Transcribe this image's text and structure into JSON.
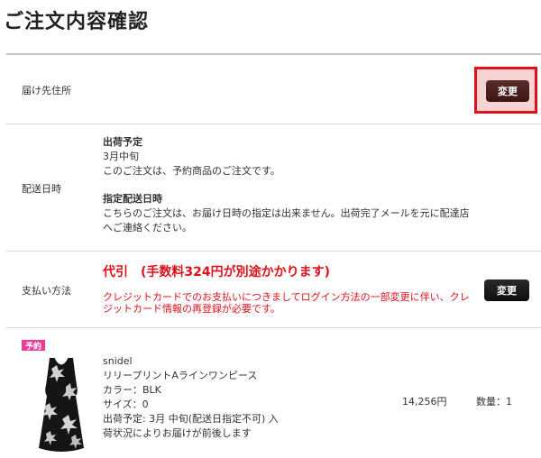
{
  "page": {
    "title": "ご注文内容確認"
  },
  "address": {
    "label": "届け先住所",
    "change_label": "変更"
  },
  "delivery": {
    "label": "配送日時",
    "ship_heading": "出荷予定",
    "ship_month": "3月中旬",
    "ship_note": "このご注文は、予約商品のご注文です。",
    "date_heading": "指定配送日時",
    "date_note_1": "こちらのご注文は、お届け日時の指定は出来ません。出荷完了メールを元に配達店",
    "date_note_2": "へご連絡ください。"
  },
  "payment": {
    "label": "支払い方法",
    "method": "代引　(手数料324円が別途かかります)",
    "notice_1": "クレジットカードでのお支払いにつきましてログイン方法の一部変更に伴い、クレ",
    "notice_2": "ジットカード情報の再登録が必要です。",
    "change_label": "変更"
  },
  "item": {
    "badge": "予約",
    "brand": "snidel",
    "name": "リリープリントAラインワンピース",
    "color": "カラー：BLK",
    "size": "サイズ：0",
    "ship_info": "出荷予定: 3月 中旬(配送日指定不可) 入",
    "ship_info_2": "荷状況によりお届けが前後します",
    "price": "14,256円",
    "quantity": "数量：1"
  },
  "colors": {
    "accent_red": "#e0101a",
    "badge_pink": "#e93c9b",
    "button_dark": "#111111"
  }
}
